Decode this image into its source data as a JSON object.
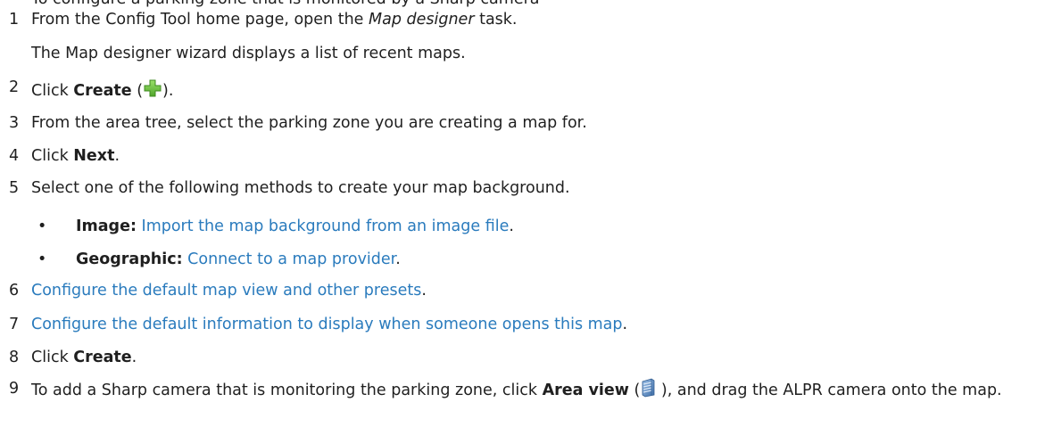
{
  "partial_top_line": "To configure a parking zone that is monitored by a Sharp camera",
  "steps": [
    {
      "num": "1",
      "pre": "From the Config Tool home page, open the ",
      "em": "Map designer",
      "post": " task.",
      "result": "The Map designer wizard displays a list of recent maps."
    },
    {
      "num": "2",
      "pre": "Click ",
      "bold": "Create",
      "open": " (",
      "icon": "green-plus-icon",
      "close": ")."
    },
    {
      "num": "3",
      "text": "From the area tree, select the parking zone you are creating a map for."
    },
    {
      "num": "4",
      "pre": "Click ",
      "bold": "Next",
      "post": "."
    },
    {
      "num": "5",
      "text": "Select one of the following methods to create your map background.",
      "options": [
        {
          "bullet": "•",
          "label": "Image:",
          "link": "Import the map background from an image file",
          "tail": "."
        },
        {
          "bullet": "•",
          "label": "Geographic:",
          "link": "Connect to a map provider",
          "tail": "."
        }
      ]
    },
    {
      "num": "6",
      "link": "Configure the default map view and other presets",
      "tail": "."
    },
    {
      "num": "7",
      "link": "Configure the default information to display when someone opens this map",
      "tail": "."
    },
    {
      "num": "8",
      "pre": "Click ",
      "bold": "Create",
      "post": "."
    },
    {
      "num": "9",
      "pre": "To add a Sharp camera that is monitoring the parking zone, click ",
      "bold": "Area view",
      "open": " (",
      "icon": "area-view-icon",
      "post": " ), and drag the ALPR camera onto the map."
    }
  ],
  "colors": {
    "text": "#1f1f1f",
    "link": "#2a7bbd",
    "icon_green": "#6bbf3b",
    "icon_blue": "#5a84b8"
  }
}
